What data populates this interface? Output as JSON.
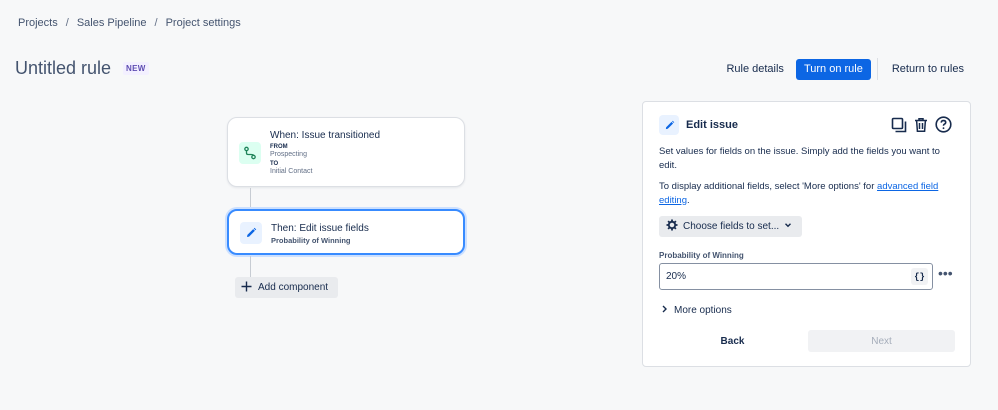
{
  "breadcrumb": {
    "items": [
      "Projects",
      "Sales Pipeline",
      "Project settings"
    ],
    "separator": "/"
  },
  "page": {
    "title": "Untitled rule",
    "badge": "NEW"
  },
  "header": {
    "rule_details": "Rule details",
    "turn_on_rule": "Turn on rule",
    "return_to_rules": "Return to rules"
  },
  "trigger": {
    "title": "When: Issue transitioned",
    "from_label": "FROM",
    "from_value": "Prospecting",
    "to_label": "TO",
    "to_value": "Initial Contact",
    "icon": "transition-icon"
  },
  "action": {
    "title": "Then: Edit issue fields",
    "subtitle": "Probability of Winning",
    "icon": "pencil-icon"
  },
  "add_component": {
    "label": "Add component"
  },
  "panel": {
    "title": "Edit issue",
    "description": "Set values for fields on the issue. Simply add the fields you want to edit.",
    "more_info_prefix": "To display additional fields, select 'More options' for ",
    "more_info_link": "advanced field editing",
    "more_info_suffix": ".",
    "choose_fields": "Choose fields to set...",
    "field_label": "Probability of Winning",
    "field_value": "20%",
    "smart_value_button": "{}",
    "more_menu": "•••",
    "more_options": "More options",
    "back": "Back",
    "next": "Next"
  },
  "colors": {
    "primary": "#0c66e4",
    "selected_border": "#388bff",
    "badge_text": "#5e4db2",
    "trigger_icon_bg": "#dcfff1",
    "action_icon_bg": "#e9f2ff"
  }
}
